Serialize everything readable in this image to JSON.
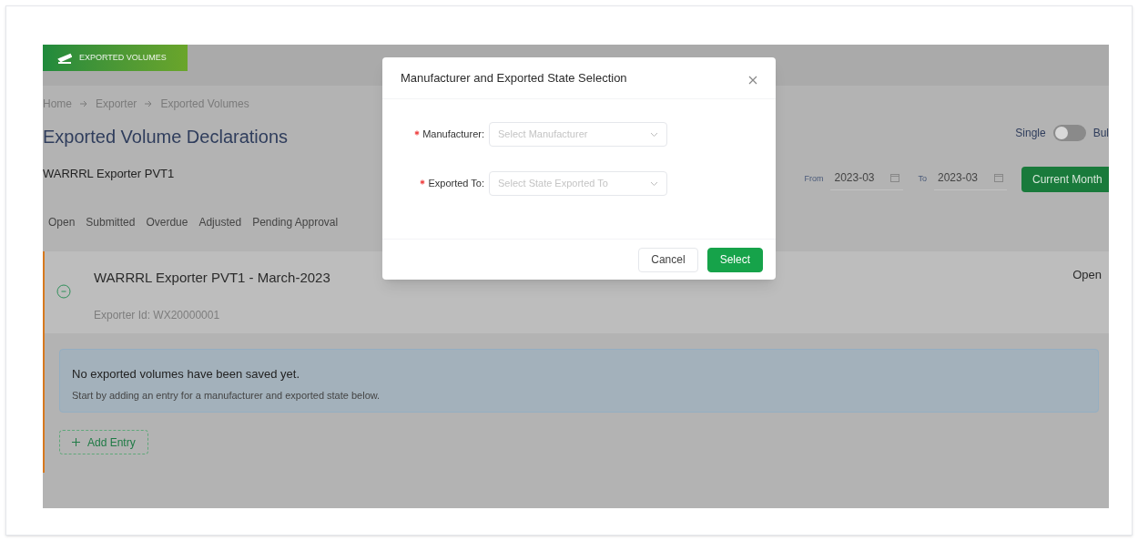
{
  "banner": {
    "label": "EXPORTED VOLUMES"
  },
  "breadcrumb": [
    "Home",
    "Exporter",
    "Exported Volumes"
  ],
  "page_title": "Exported Volume Declarations",
  "exporter_name": "WARRRL Exporter PVT1",
  "mode_toggle": {
    "left_label": "Single",
    "right_label": "Bul",
    "on": false
  },
  "date_range": {
    "from_label": "From",
    "from_value": "2023-03",
    "to_label": "To",
    "to_value": "2023-03"
  },
  "current_month_button": "Current Month",
  "status_tabs": [
    {
      "label": "Open",
      "selected": false
    },
    {
      "label": "Submitted",
      "selected": false
    },
    {
      "label": "Overdue",
      "selected": false
    },
    {
      "label": "Adjusted",
      "selected": false
    },
    {
      "label": "Pending Approval",
      "selected": false
    }
  ],
  "declaration": {
    "title": "WARRRL Exporter PVT1 - March-2023",
    "exporter_id": "Exporter Id: WX20000001",
    "status": "Open",
    "expanded": true,
    "notice": {
      "heading": "No exported volumes have been saved yet.",
      "text": "Start by adding an entry for a manufacturer and exported state below."
    },
    "add_button": "Add Entry"
  },
  "modal": {
    "title": "Manufacturer and Exported State Selection",
    "fields": [
      {
        "label": "Manufacturer:",
        "required": true,
        "placeholder": "Select Manufacturer"
      },
      {
        "label": "Exported To:",
        "required": true,
        "placeholder": "Select State Exported To"
      }
    ],
    "buttons": [
      {
        "label": "Cancel",
        "kind": "default"
      },
      {
        "label": "Select",
        "kind": "primary"
      }
    ]
  }
}
